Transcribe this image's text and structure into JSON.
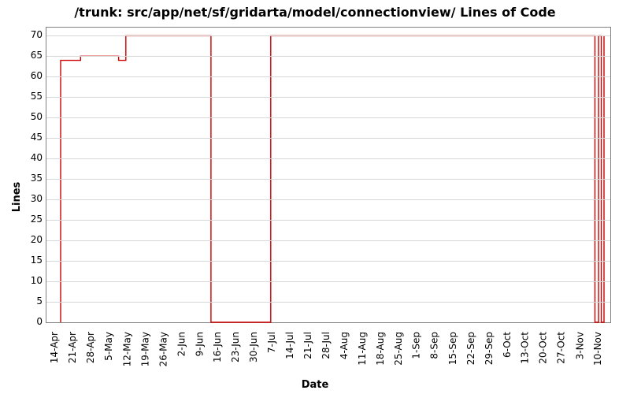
{
  "chart_data": {
    "type": "line",
    "step_mode": "hv",
    "title": "/trunk: src/app/net/sf/gridarta/model/connectionview/ Lines of Code",
    "xlabel": "Date",
    "ylabel": "Lines",
    "ylim": [
      0,
      72
    ],
    "yticks": [
      0,
      5,
      10,
      15,
      20,
      25,
      30,
      35,
      40,
      45,
      50,
      55,
      60,
      65,
      70
    ],
    "x_categories": [
      "14-Apr",
      "21-Apr",
      "28-Apr",
      "5-May",
      "12-May",
      "19-May",
      "26-May",
      "2-Jun",
      "9-Jun",
      "16-Jun",
      "23-Jun",
      "30-Jun",
      "7-Jul",
      "14-Jul",
      "21-Jul",
      "28-Jul",
      "4-Aug",
      "11-Aug",
      "18-Aug",
      "25-Aug",
      "1-Sep",
      "8-Sep",
      "15-Sep",
      "22-Sep",
      "29-Sep",
      "6-Oct",
      "13-Oct",
      "20-Oct",
      "27-Oct",
      "3-Nov",
      "10-Nov"
    ],
    "series": [
      {
        "name": "Lines of Code",
        "color": "#cc0000",
        "points": [
          {
            "x_index": 0.0,
            "y": 0
          },
          {
            "x_index": 0.0,
            "y": 64
          },
          {
            "x_index": 1.1,
            "y": 64
          },
          {
            "x_index": 1.1,
            "y": 65
          },
          {
            "x_index": 2.4,
            "y": 65
          },
          {
            "x_index": 2.4,
            "y": 65
          },
          {
            "x_index": 3.2,
            "y": 65
          },
          {
            "x_index": 3.2,
            "y": 64
          },
          {
            "x_index": 3.6,
            "y": 64
          },
          {
            "x_index": 3.6,
            "y": 70
          },
          {
            "x_index": 8.3,
            "y": 70
          },
          {
            "x_index": 8.3,
            "y": 0
          },
          {
            "x_index": 11.6,
            "y": 0
          },
          {
            "x_index": 11.6,
            "y": 70
          },
          {
            "x_index": 29.5,
            "y": 70
          },
          {
            "x_index": 29.5,
            "y": 0
          },
          {
            "x_index": 29.7,
            "y": 0
          },
          {
            "x_index": 29.7,
            "y": 70
          },
          {
            "x_index": 29.85,
            "y": 70
          },
          {
            "x_index": 29.85,
            "y": 0
          },
          {
            "x_index": 30.0,
            "y": 0
          },
          {
            "x_index": 30.0,
            "y": 70
          }
        ]
      }
    ]
  }
}
